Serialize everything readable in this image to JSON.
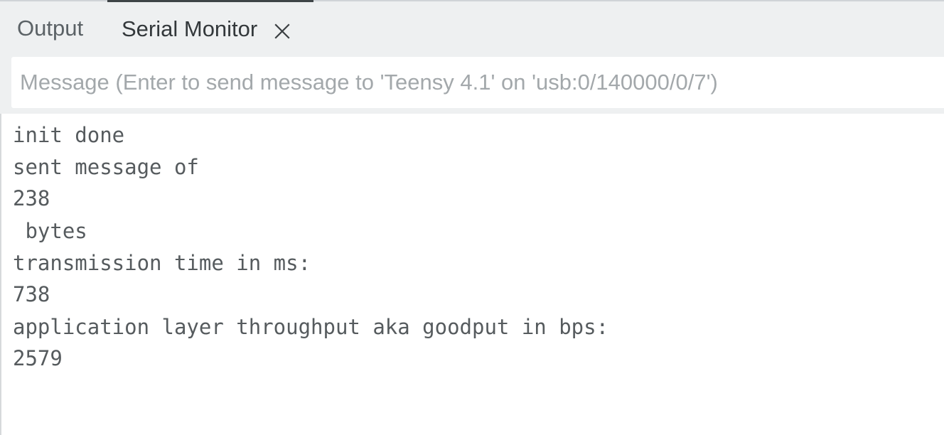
{
  "tabs": [
    {
      "label": "Output",
      "active": false
    },
    {
      "label": "Serial Monitor",
      "active": true
    }
  ],
  "icons": {
    "close": "close-icon"
  },
  "message": {
    "value": "",
    "placeholder": "Message (Enter to send message to 'Teensy 4.1' on 'usb:0/140000/0/7')"
  },
  "log": [
    "init done",
    "sent message of",
    "238",
    " bytes",
    "transmission time in ms:",
    "738",
    "application layer throughput aka goodput in bps:",
    "2579"
  ],
  "colors": {
    "tabbar_bg": "#eef0f1",
    "active_tab_indicator": "#3e4447",
    "log_text": "#565b5e",
    "placeholder_text": "#a3a8ab"
  }
}
